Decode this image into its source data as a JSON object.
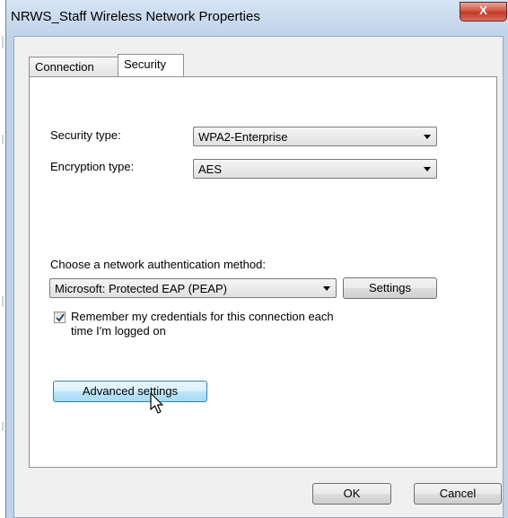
{
  "window": {
    "title": "NRWS_Staff Wireless Network Properties",
    "close_glyph": "X"
  },
  "tabs": [
    {
      "label": "Connection",
      "active": false
    },
    {
      "label": "Security",
      "active": true
    }
  ],
  "security": {
    "security_type_label": "Security type:",
    "security_type_value": "WPA2-Enterprise",
    "encryption_type_label": "Encryption type:",
    "encryption_type_value": "AES",
    "auth_method_label": "Choose a network authentication method:",
    "auth_method_value": "Microsoft: Protected EAP (PEAP)",
    "settings_label": "Settings",
    "remember_checked": true,
    "remember_line1": "Remember my credentials for this connection each",
    "remember_line2": "time I'm logged on",
    "advanced_label": "Advanced settings"
  },
  "footer": {
    "ok_label": "OK",
    "cancel_label": "Cancel"
  },
  "icons": {
    "close": "close-icon",
    "dropdown": "chevron-down-icon",
    "check": "checkmark-icon",
    "cursor": "mouse-pointer-icon"
  }
}
